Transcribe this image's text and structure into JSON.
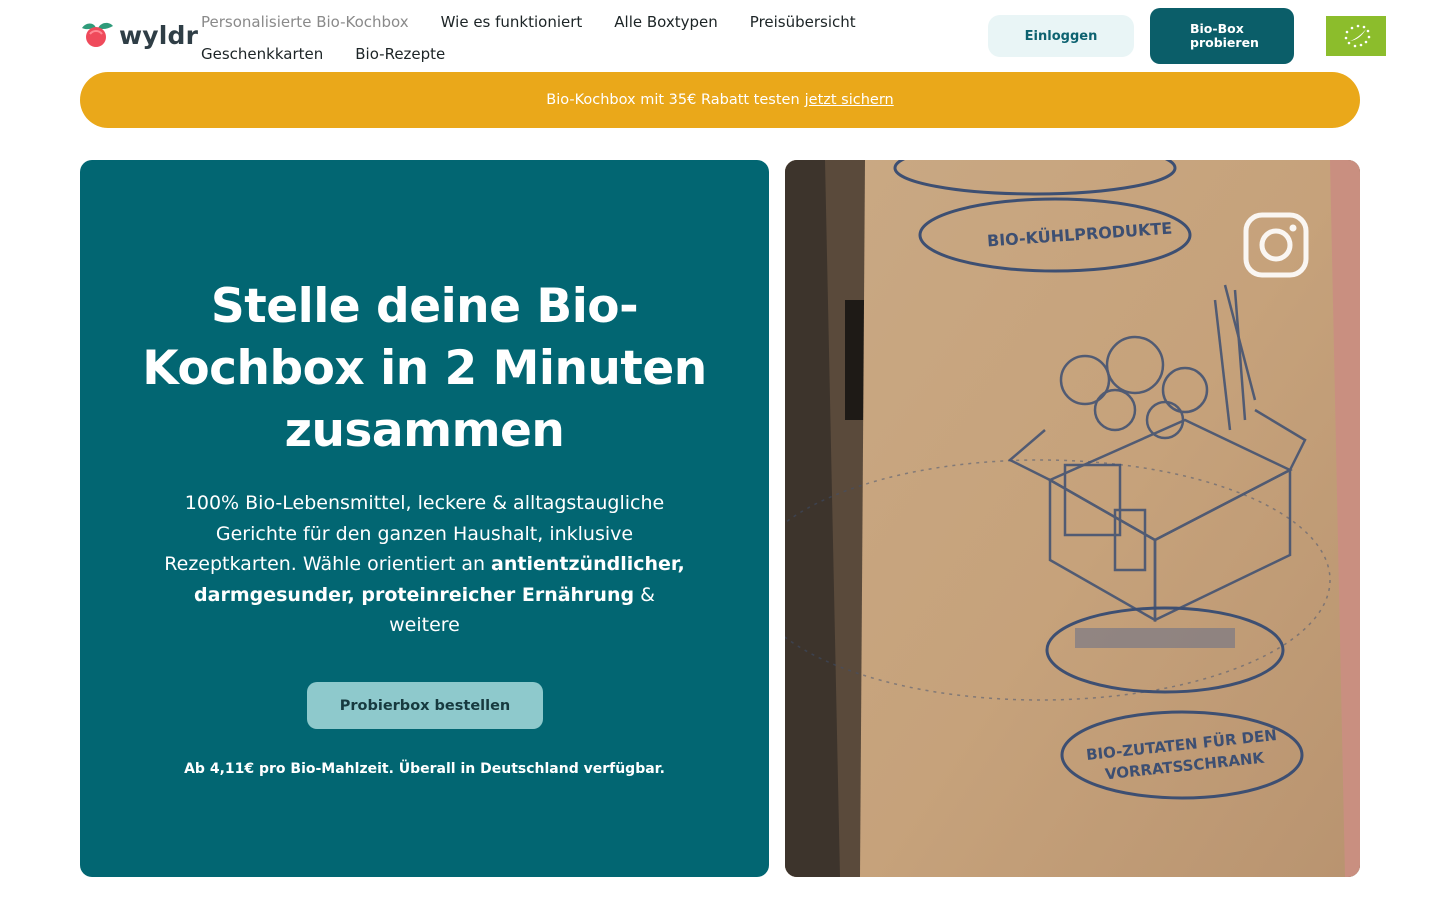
{
  "brand": {
    "logo_text": "wyldr"
  },
  "nav": {
    "row1": [
      {
        "label": "Personalisierte Bio-Kochbox",
        "active": true
      },
      {
        "label": "Wie es funktioniert"
      },
      {
        "label": "Alle Boxtypen"
      },
      {
        "label": "Preisübersicht"
      }
    ],
    "row2": [
      {
        "label": "Geschenkkarten"
      },
      {
        "label": "Bio-Rezepte"
      }
    ]
  },
  "header": {
    "login_label": "Einloggen",
    "try_label_line1": "Bio-Box",
    "try_label_line2": "probieren"
  },
  "banner": {
    "text": "Bio-Kochbox mit 35€ Rabatt testen",
    "link": "jetzt sichern"
  },
  "hero": {
    "title": "Stelle deine Bio-Kochbox in 2 Minuten zusammen",
    "desc_part1": "100% Bio-Lebensmittel, leckere & alltagstaugliche Gerichte für den ganzen Haushalt, inklusive Rezeptkarten. Wähle orientiert an ",
    "desc_bold": "antientzündlicher, darmgesunder, proteinreicher Ernährung",
    "desc_part2": " & weitere",
    "cta_label": "Probierbox bestellen",
    "note": "Ab 4,11€ pro Bio-Mahlzeit. Überall in Deutschland verfügbar."
  },
  "media": {
    "box_label_1": "BIO-KÜHLPRODUKTE",
    "box_label_2_line1": "BIO-ZUTATEN FÜR DEN",
    "box_label_2_line2": "VORRATSSCHRANK"
  },
  "colors": {
    "brand_teal": "#026672",
    "banner_yellow": "#eaa81a",
    "cta_light_teal": "#8ec9cc",
    "eu_green": "#8cbd2c"
  },
  "icons": [
    "leaf-logo-icon",
    "eu-organic-logo",
    "instagram-icon"
  ]
}
